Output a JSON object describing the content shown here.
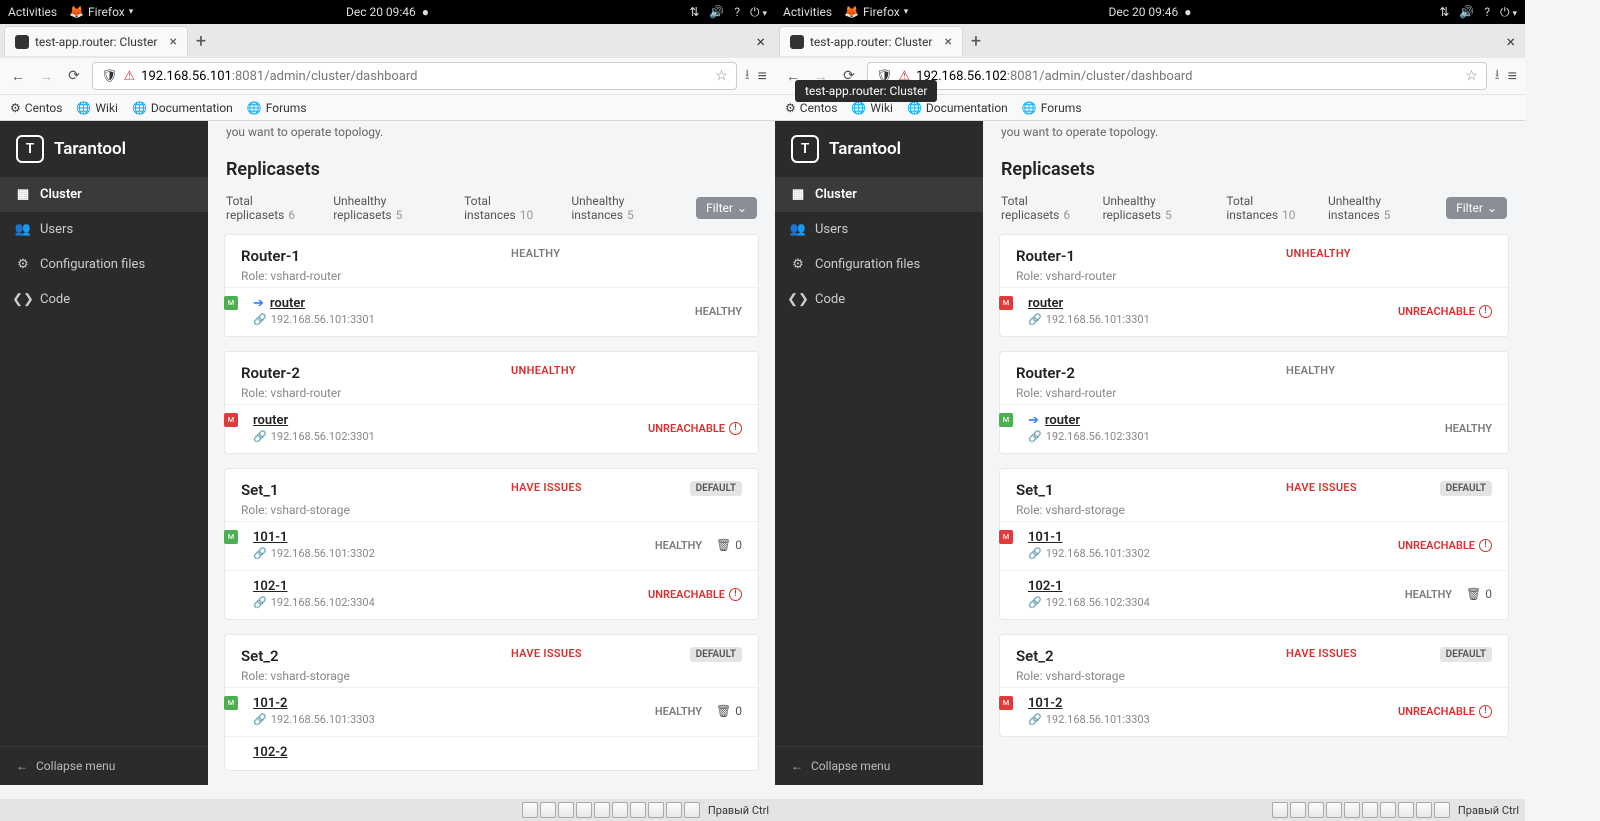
{
  "gnome": {
    "activities": "Activities",
    "app": "Firefox",
    "datetime": "Dec 20  09:46"
  },
  "left": {
    "tab_title": "test-app.router: Cluster",
    "url_host": "192.168.56.101",
    "url_port_path": ":8081/admin/cluster/dashboard",
    "bookmarks": [
      "Centos",
      "Wiki",
      "Documentation",
      "Forums"
    ],
    "app_name": "Tarantool",
    "nav": [
      "Cluster",
      "Users",
      "Configuration files",
      "Code"
    ],
    "collapse": "Collapse menu",
    "banner_frag": "you want to operate topology.",
    "section": "Replicasets",
    "stats": {
      "total_rs_label": "Total replicasets",
      "total_rs": "6",
      "unh_rs_label": "Unhealthy replicasets",
      "unh_rs": "5",
      "total_inst_label": "Total instances",
      "total_inst": "10",
      "unh_inst_label": "Unhealthy instances",
      "unh_inst": "5",
      "filter": "Filter"
    },
    "cards": [
      {
        "name": "Router-1",
        "role": "Role: vshard-router",
        "status": "HEALTHY",
        "status_kind": "healthy",
        "default": false,
        "instances": [
          {
            "tag": "green",
            "leader": true,
            "name": "router",
            "addr": "192.168.56.101:3301",
            "status": "HEALTHY",
            "status_kind": "healthy",
            "bucket": null
          }
        ]
      },
      {
        "name": "Router-2",
        "role": "Role: vshard-router",
        "status": "UNHEALTHY",
        "status_kind": "bad",
        "default": false,
        "instances": [
          {
            "tag": "red",
            "leader": false,
            "name": "router",
            "addr": "192.168.56.102:3301",
            "status": "UNREACHABLE",
            "status_kind": "bad",
            "bucket": null
          }
        ]
      },
      {
        "name": "Set_1",
        "role": "Role: vshard-storage",
        "status": "HAVE ISSUES",
        "status_kind": "bad",
        "default": true,
        "instances": [
          {
            "tag": "green",
            "leader": false,
            "name": "101-1",
            "addr": "192.168.56.101:3302",
            "status": "HEALTHY",
            "status_kind": "healthy",
            "bucket": "0"
          },
          {
            "tag": null,
            "leader": false,
            "name": "102-1",
            "addr": "192.168.56.102:3304",
            "status": "UNREACHABLE",
            "status_kind": "bad",
            "bucket": null
          }
        ]
      },
      {
        "name": "Set_2",
        "role": "Role: vshard-storage",
        "status": "HAVE ISSUES",
        "status_kind": "bad",
        "default": true,
        "instances": [
          {
            "tag": "green",
            "leader": false,
            "name": "101-2",
            "addr": "192.168.56.101:3303",
            "status": "HEALTHY",
            "status_kind": "healthy",
            "bucket": "0"
          },
          {
            "tag": null,
            "leader": false,
            "name": "102-2",
            "addr": "",
            "status": "",
            "status_kind": "healthy",
            "bucket": null
          }
        ]
      }
    ]
  },
  "right": {
    "tab_title": "test-app.router: Cluster",
    "tooltip": "test-app.router: Cluster",
    "url_host": "192.168.56.102",
    "url_port_path": ":8081/admin/cluster/dashboard",
    "bookmarks": [
      "Centos",
      "Wiki",
      "Documentation",
      "Forums"
    ],
    "app_name": "Tarantool",
    "nav": [
      "Cluster",
      "Users",
      "Configuration files",
      "Code"
    ],
    "collapse": "Collapse menu",
    "banner_frag": "you want to operate topology.",
    "section": "Replicasets",
    "stats": {
      "total_rs_label": "Total replicasets",
      "total_rs": "6",
      "unh_rs_label": "Unhealthy replicasets",
      "unh_rs": "5",
      "total_inst_label": "Total instances",
      "total_inst": "10",
      "unh_inst_label": "Unhealthy instances",
      "unh_inst": "5",
      "filter": "Filter"
    },
    "cards": [
      {
        "name": "Router-1",
        "role": "Role: vshard-router",
        "status": "UNHEALTHY",
        "status_kind": "bad",
        "default": false,
        "instances": [
          {
            "tag": "red",
            "leader": false,
            "name": "router",
            "addr": "192.168.56.101:3301",
            "status": "UNREACHABLE",
            "status_kind": "bad",
            "bucket": null
          }
        ]
      },
      {
        "name": "Router-2",
        "role": "Role: vshard-router",
        "status": "HEALTHY",
        "status_kind": "healthy",
        "default": false,
        "instances": [
          {
            "tag": "green",
            "leader": true,
            "name": "router",
            "addr": "192.168.56.102:3301",
            "status": "HEALTHY",
            "status_kind": "healthy",
            "bucket": null
          }
        ]
      },
      {
        "name": "Set_1",
        "role": "Role: vshard-storage",
        "status": "HAVE ISSUES",
        "status_kind": "bad",
        "default": true,
        "instances": [
          {
            "tag": "red",
            "leader": false,
            "name": "101-1",
            "addr": "192.168.56.101:3302",
            "status": "UNREACHABLE",
            "status_kind": "bad",
            "bucket": null
          },
          {
            "tag": null,
            "leader": false,
            "name": "102-1",
            "addr": "192.168.56.102:3304",
            "status": "HEALTHY",
            "status_kind": "healthy",
            "bucket": "0"
          }
        ]
      },
      {
        "name": "Set_2",
        "role": "Role: vshard-storage",
        "status": "HAVE ISSUES",
        "status_kind": "bad",
        "default": true,
        "instances": [
          {
            "tag": "red",
            "leader": false,
            "name": "101-2",
            "addr": "192.168.56.101:3303",
            "status": "UNREACHABLE",
            "status_kind": "bad",
            "bucket": null
          }
        ]
      }
    ]
  },
  "taskbar": {
    "indicator": "Правый Ctrl"
  },
  "default_label": "DEFAULT"
}
